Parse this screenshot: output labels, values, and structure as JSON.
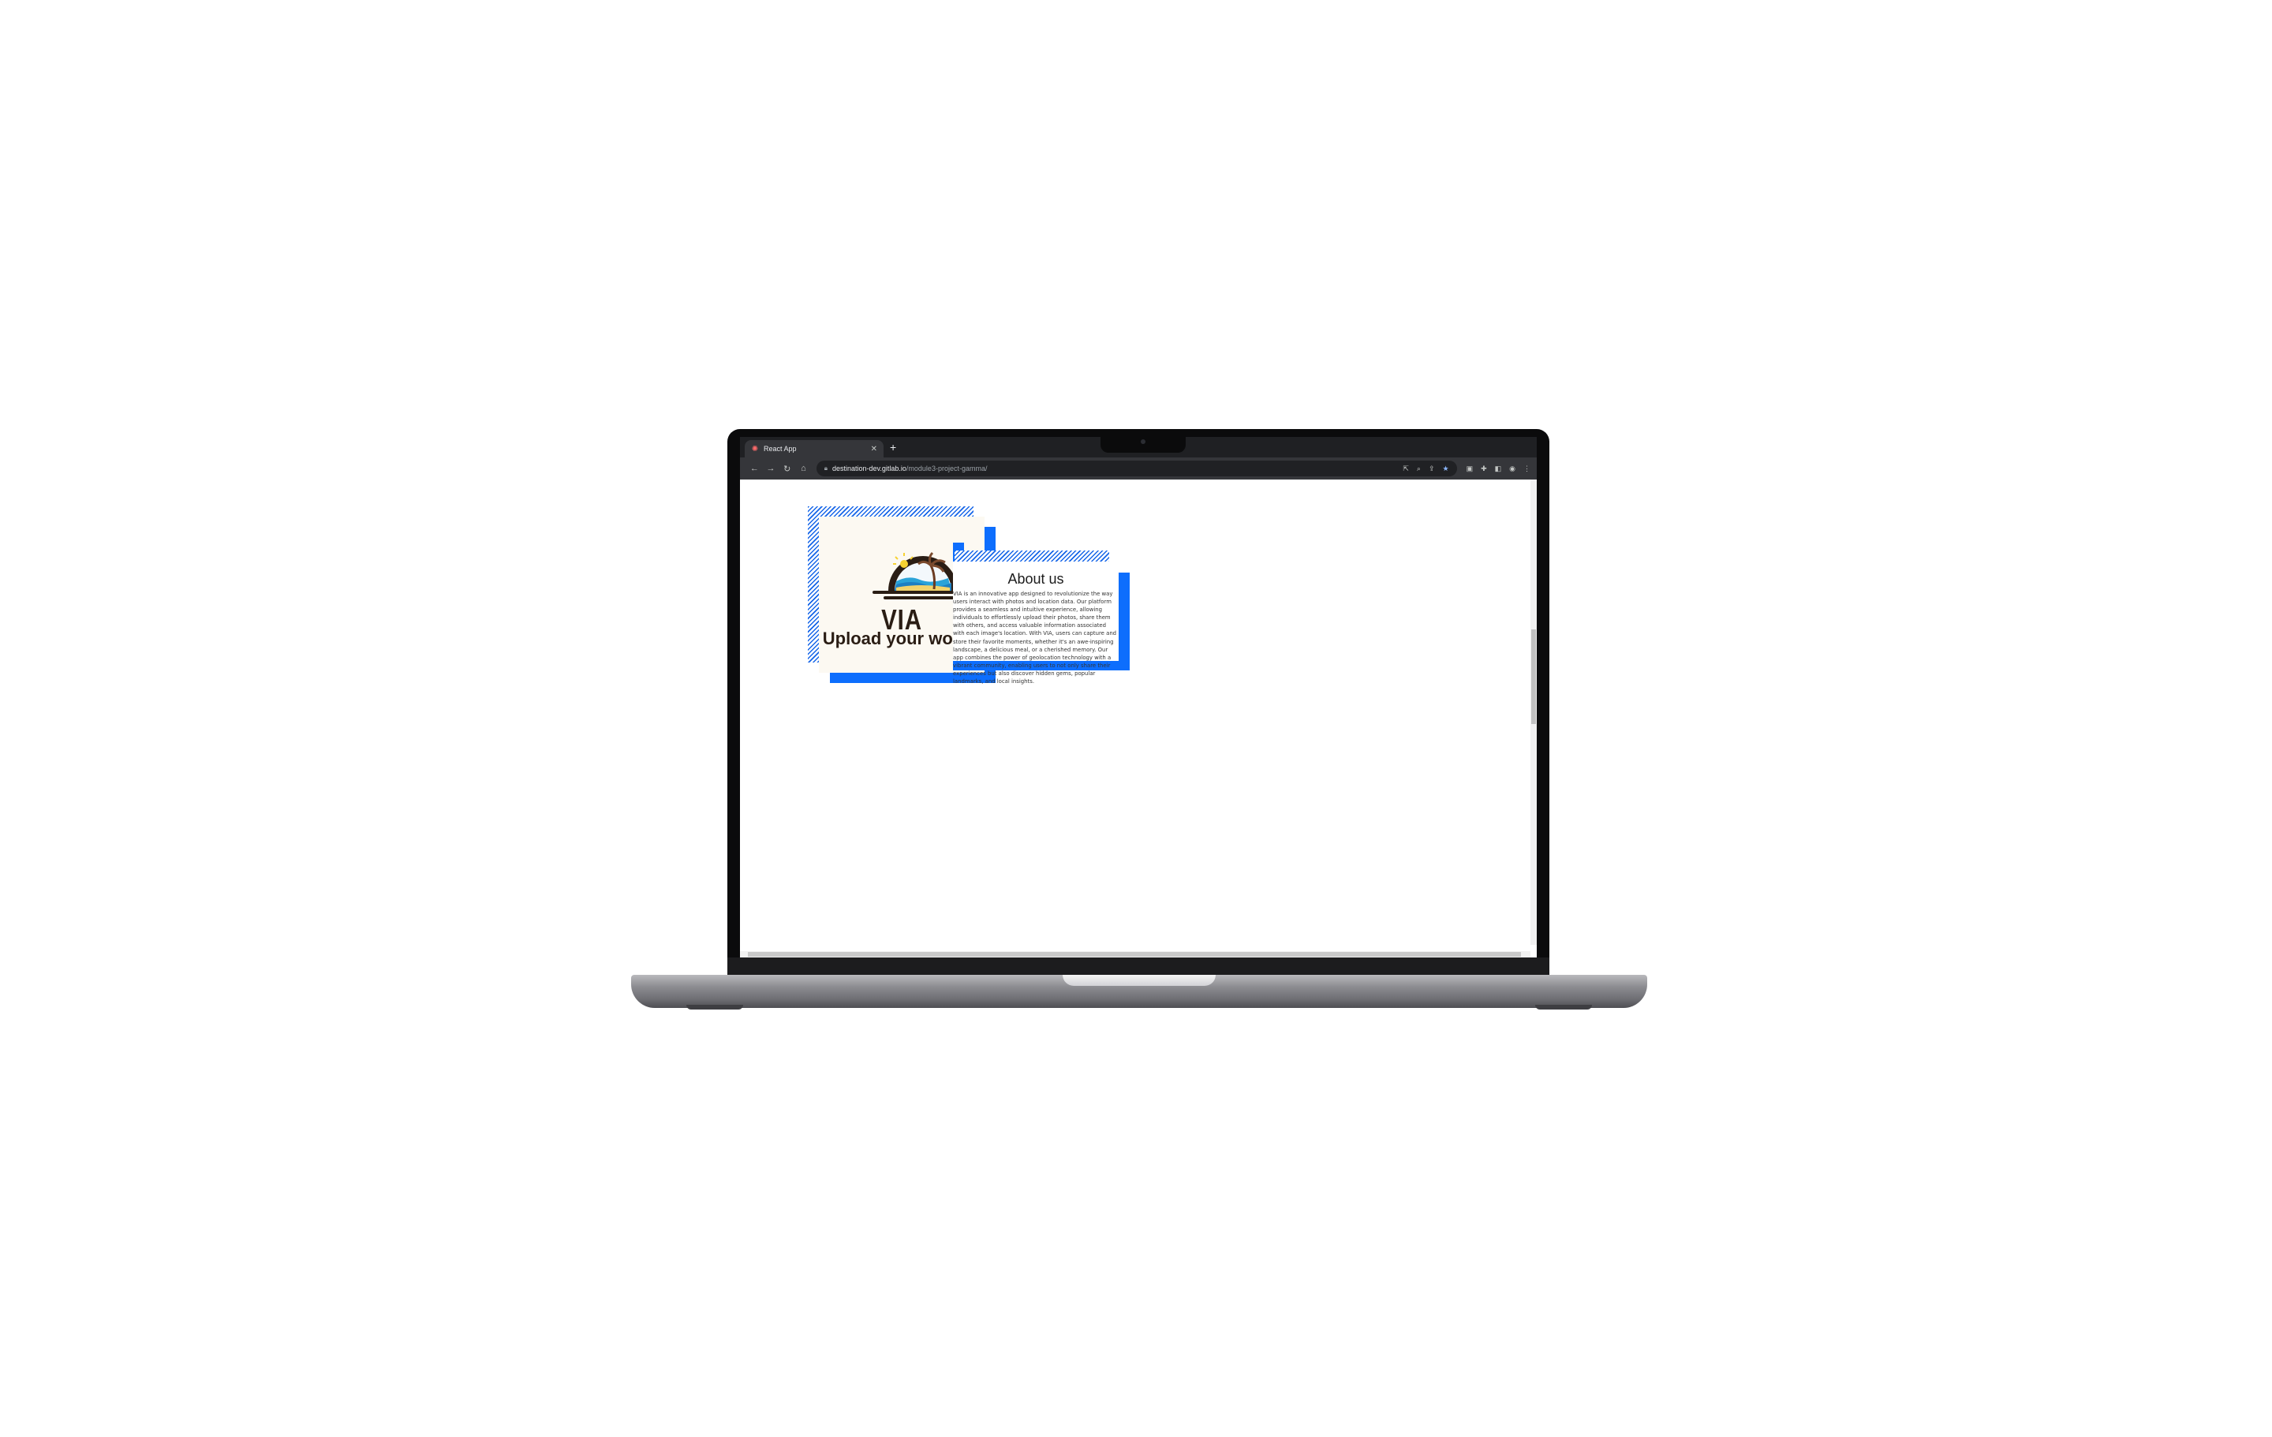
{
  "browser": {
    "tab_title": "React App",
    "url_host": "destination-dev.gitlab.io",
    "url_path": "/module3-project-gamma/"
  },
  "hero": {
    "brand": "VIA",
    "slogan": "Upload your world!"
  },
  "about": {
    "title": "About us",
    "body": "VIA is an innovative app designed to revolutionize the way users interact with photos and location data. Our platform provides a seamless and intuitive experience, allowing individuals to effortlessly upload their photos, share them with others, and access valuable information associated with each image's location. With VIA, users can capture and store their favorite moments, whether it's an awe-inspiring landscape, a delicious meal, or a cherished memory. Our app combines the power of geolocation technology with a vibrant community, enabling users to not only share their experiences but also discover hidden gems, popular landmarks, and local insights."
  },
  "colors": {
    "accent_blue": "#0d6efd",
    "card_background": "#fcf9f2",
    "brand_brown": "#2a1d14"
  }
}
